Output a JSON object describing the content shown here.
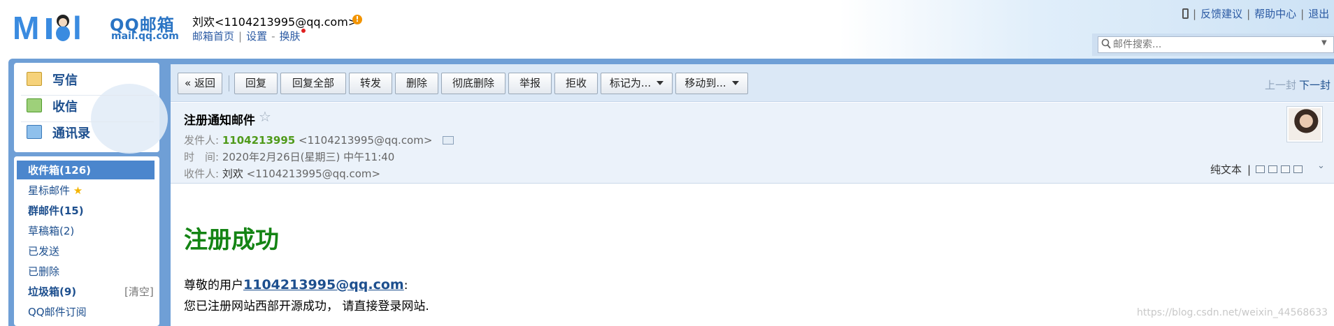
{
  "header": {
    "logo_cn": "QQ邮箱",
    "logo_en": "mail.qq.com",
    "user": "刘欢<1104213995@qq.com>",
    "warning_icon": "exclamation-icon",
    "links": [
      "邮箱首页",
      "设置",
      "换肤"
    ],
    "right_links": [
      "反馈建议",
      "帮助中心",
      "退出"
    ],
    "search_placeholder": "邮件搜索..."
  },
  "sidebar": {
    "nav": [
      {
        "label": "写信",
        "icon": "compose-icon"
      },
      {
        "label": "收信",
        "icon": "inbox-download-icon"
      },
      {
        "label": "通讯录",
        "icon": "contacts-icon"
      }
    ],
    "folders": [
      {
        "label": "收件箱(126)",
        "selected": true
      },
      {
        "label": "星标邮件",
        "star": "★"
      },
      {
        "label": "群邮件(15)"
      },
      {
        "label": "草稿箱(2)"
      },
      {
        "label": "已发送"
      },
      {
        "label": "已删除"
      },
      {
        "label": "垃圾箱(9)",
        "action": "[清空]"
      },
      {
        "label": "QQ邮件订阅"
      }
    ]
  },
  "toolbar": {
    "back": "« 返回",
    "buttons": [
      "回复",
      "回复全部",
      "转发",
      "删除",
      "彻底删除",
      "举报",
      "拒收"
    ],
    "mark_as": "标记为...",
    "move_to": "移动到...",
    "prev": "上一封",
    "next": "下一封"
  },
  "mail": {
    "subject": "注册通知邮件",
    "star": "☆",
    "from_label": "发件人:",
    "from_name": "1104213995",
    "from_addr": "<1104213995@qq.com>",
    "time_label": "时　间:",
    "time_value": "2020年2月26日(星期三) 中午11:40",
    "to_label": "收件人:",
    "to_name": "刘欢",
    "to_addr": "<1104213995@qq.com>",
    "plain_text": "纯文本",
    "body_title": "注册成功",
    "greeting_prefix": "尊敬的用户",
    "greeting_link": "1104213995@qq.com",
    "greeting_suffix": ":",
    "body_line": "您已注册网站西部开源成功， 请直接登录网站."
  },
  "watermark": "https://blog.csdn.net/weixin_44568633",
  "colors": {
    "frame_blue": "#6f9fd6",
    "selected_folder": "#4b86cd",
    "title_green": "#148414",
    "sender_green": "#4f9a1a"
  }
}
